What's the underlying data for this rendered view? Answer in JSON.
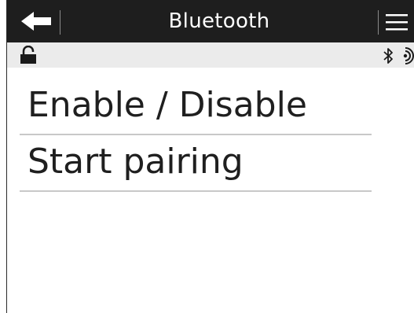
{
  "header": {
    "title": "Bluetooth",
    "back_icon": "arrow-left-icon",
    "menu_icon": "hamburger-menu-icon"
  },
  "status_bar": {
    "lock_icon": "lock-icon",
    "bluetooth_icon": "bluetooth-icon",
    "signal_icon": "wireless-signal-icon"
  },
  "menu": {
    "items": [
      {
        "label": "Enable / Disable"
      },
      {
        "label": "Start pairing"
      }
    ]
  },
  "colors": {
    "header_bg": "#1e1e1e",
    "status_bg": "#ebebeb",
    "divider": "#c8c8c8",
    "text": "#1f1f1f"
  }
}
